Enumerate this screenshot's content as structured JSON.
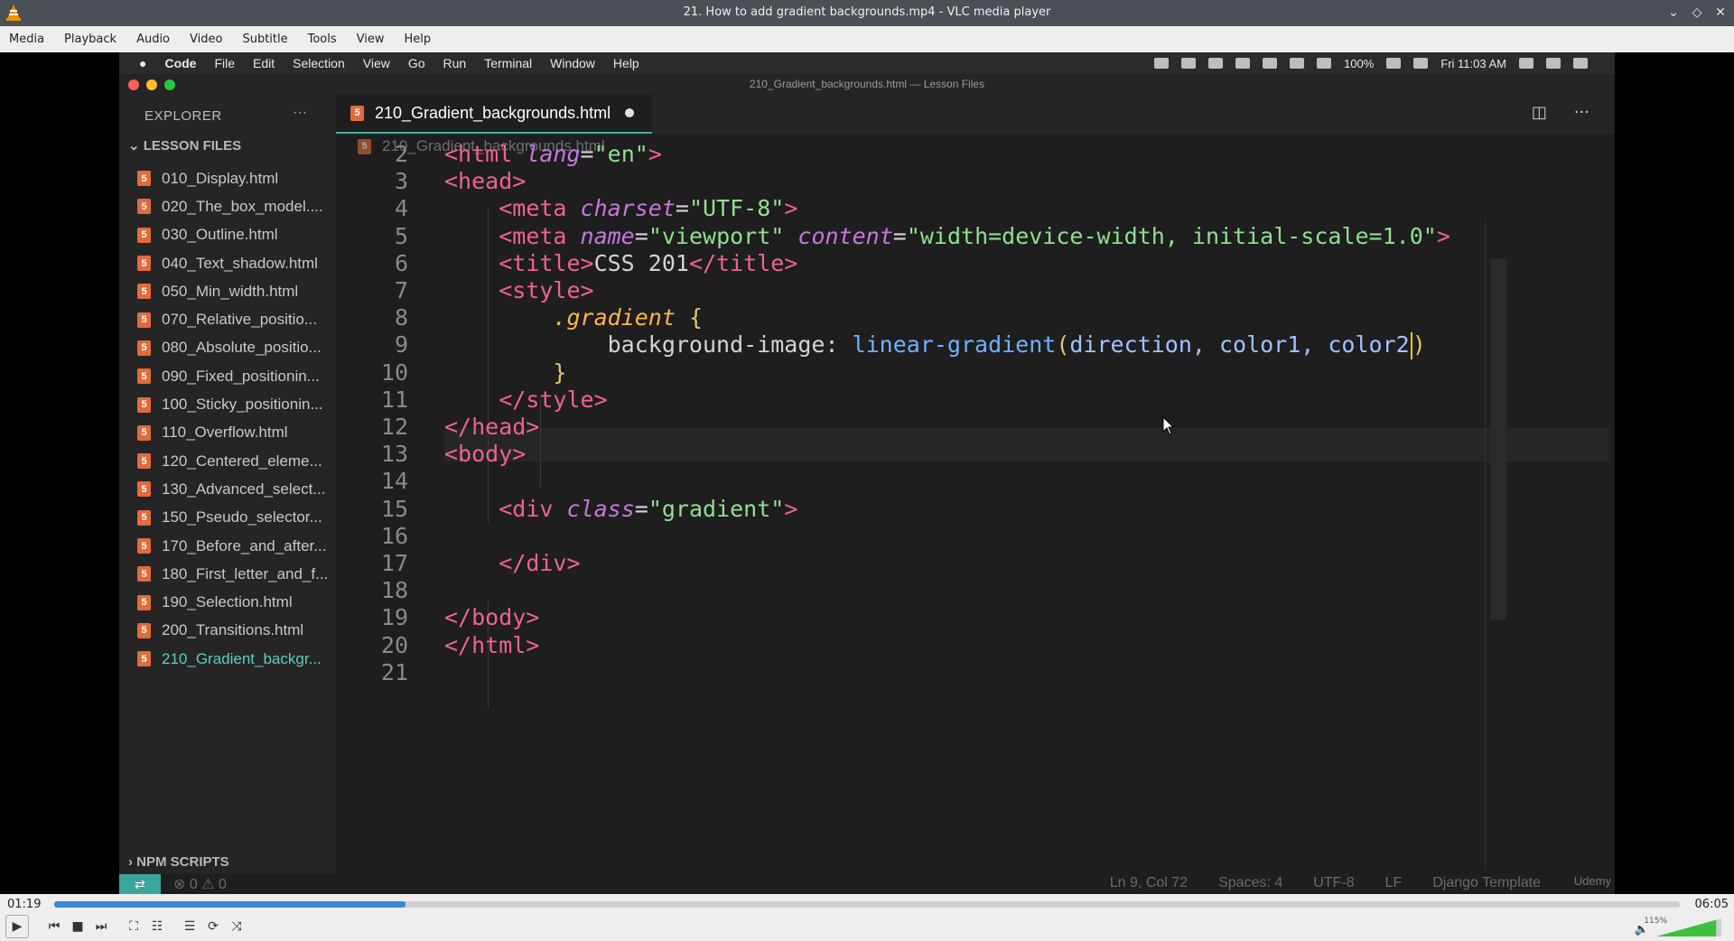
{
  "window": {
    "title": "21. How to add gradient backgrounds.mp4 - VLC media player"
  },
  "vlc_menu": [
    "Media",
    "Playback",
    "Audio",
    "Video",
    "Subtitle",
    "Tools",
    "View",
    "Help"
  ],
  "mac_menu": {
    "apple": "",
    "app": "Code",
    "items": [
      "File",
      "Edit",
      "Selection",
      "View",
      "Go",
      "Run",
      "Terminal",
      "Window",
      "Help"
    ],
    "battery": "100%",
    "clock": "Fri 11:03 AM"
  },
  "vscode": {
    "window_title": "210_Gradient_backgrounds.html — Lesson Files",
    "explorer_label": "EXPLORER",
    "lesson_folder": "LESSON FILES",
    "npm_scripts": "NPM SCRIPTS",
    "files": [
      "010_Display.html",
      "020_The_box_model....",
      "030_Outline.html",
      "040_Text_shadow.html",
      "050_Min_width.html",
      "070_Relative_positio...",
      "080_Absolute_positio...",
      "090_Fixed_positionin...",
      "100_Sticky_positionin...",
      "110_Overflow.html",
      "120_Centered_eleme...",
      "130_Advanced_select...",
      "150_Pseudo_selector...",
      "170_Before_and_after...",
      "180_First_letter_and_f...",
      "190_Selection.html",
      "200_Transitions.html",
      "210_Gradient_backgr..."
    ],
    "active_tab": "210_Gradient_backgrounds.html",
    "breadcrumb": "210_Gradient_backgrounds.html",
    "code_lines": [
      {
        "n": "2",
        "parts": [
          [
            "tag",
            "<html "
          ],
          [
            "attr",
            "lang"
          ],
          [
            "txtc",
            "="
          ],
          [
            "str",
            "\"en\""
          ],
          [
            "tag",
            ">"
          ]
        ]
      },
      {
        "n": "3",
        "parts": [
          [
            "tag",
            "<head>"
          ]
        ]
      },
      {
        "n": "4",
        "parts": [
          [
            "txtc",
            "    "
          ],
          [
            "tag",
            "<meta "
          ],
          [
            "attr",
            "charset"
          ],
          [
            "txtc",
            "="
          ],
          [
            "str",
            "\"UTF-8\""
          ],
          [
            "tag",
            ">"
          ]
        ]
      },
      {
        "n": "5",
        "parts": [
          [
            "txtc",
            "    "
          ],
          [
            "tag",
            "<meta "
          ],
          [
            "attr",
            "name"
          ],
          [
            "txtc",
            "="
          ],
          [
            "str",
            "\"viewport\""
          ],
          [
            "txtc",
            " "
          ],
          [
            "attr",
            "content"
          ],
          [
            "txtc",
            "="
          ],
          [
            "str",
            "\"width=device-width, initial-scale=1.0\""
          ],
          [
            "tag",
            ">"
          ]
        ]
      },
      {
        "n": "6",
        "parts": [
          [
            "txtc",
            "    "
          ],
          [
            "tag",
            "<title>"
          ],
          [
            "txtc",
            "CSS 201"
          ],
          [
            "tag",
            "</title>"
          ]
        ]
      },
      {
        "n": "7",
        "parts": [
          [
            "txtc",
            "    "
          ],
          [
            "tag",
            "<style>"
          ]
        ]
      },
      {
        "n": "8",
        "parts": [
          [
            "txtc",
            "        "
          ],
          [
            "sel",
            ".gradient"
          ],
          [
            "txtc",
            " "
          ],
          [
            "brace",
            "{"
          ]
        ]
      },
      {
        "n": "9",
        "parts": [
          [
            "txtc",
            "            "
          ],
          [
            "prop",
            "background-image: "
          ],
          [
            "fn",
            "linear-gradient"
          ],
          [
            "brace",
            "("
          ],
          [
            "arg",
            "direction, color1, color2"
          ],
          [
            "caret",
            ""
          ],
          [
            "brace",
            ")"
          ]
        ]
      },
      {
        "n": "10",
        "parts": [
          [
            "txtc",
            "        "
          ],
          [
            "brace",
            "}"
          ]
        ]
      },
      {
        "n": "11",
        "parts": [
          [
            "txtc",
            "    "
          ],
          [
            "tag",
            "</style>"
          ]
        ]
      },
      {
        "n": "12",
        "parts": [
          [
            "tag",
            "</head>"
          ]
        ]
      },
      {
        "n": "13",
        "parts": [
          [
            "tag",
            "<body>"
          ]
        ]
      },
      {
        "n": "14",
        "parts": []
      },
      {
        "n": "15",
        "parts": [
          [
            "txtc",
            "    "
          ],
          [
            "tag",
            "<div "
          ],
          [
            "attr",
            "class"
          ],
          [
            "txtc",
            "="
          ],
          [
            "str",
            "\"gradient\""
          ],
          [
            "tag",
            ">"
          ]
        ]
      },
      {
        "n": "16",
        "parts": []
      },
      {
        "n": "17",
        "parts": [
          [
            "txtc",
            "    "
          ],
          [
            "tag",
            "</div>"
          ]
        ]
      },
      {
        "n": "18",
        "parts": []
      },
      {
        "n": "19",
        "parts": [
          [
            "tag",
            "</body>"
          ]
        ]
      },
      {
        "n": "20",
        "parts": [
          [
            "tag",
            "</html>"
          ]
        ]
      },
      {
        "n": "21",
        "parts": []
      }
    ],
    "status": {
      "problems": "⊗ 0 ⚠ 0",
      "position": "Ln 9, Col 72",
      "spaces": "Spaces: 4",
      "encoding": "UTF-8",
      "eol": "LF",
      "language": "Django Template",
      "watermark": "Udemy"
    }
  },
  "player": {
    "elapsed": "01:19",
    "total": "06:05",
    "progress": 0.216,
    "volume_label": "115%",
    "volume": 1.15
  },
  "colors": {
    "accent": "#3fb0a4",
    "seek": "#3b87d9"
  }
}
